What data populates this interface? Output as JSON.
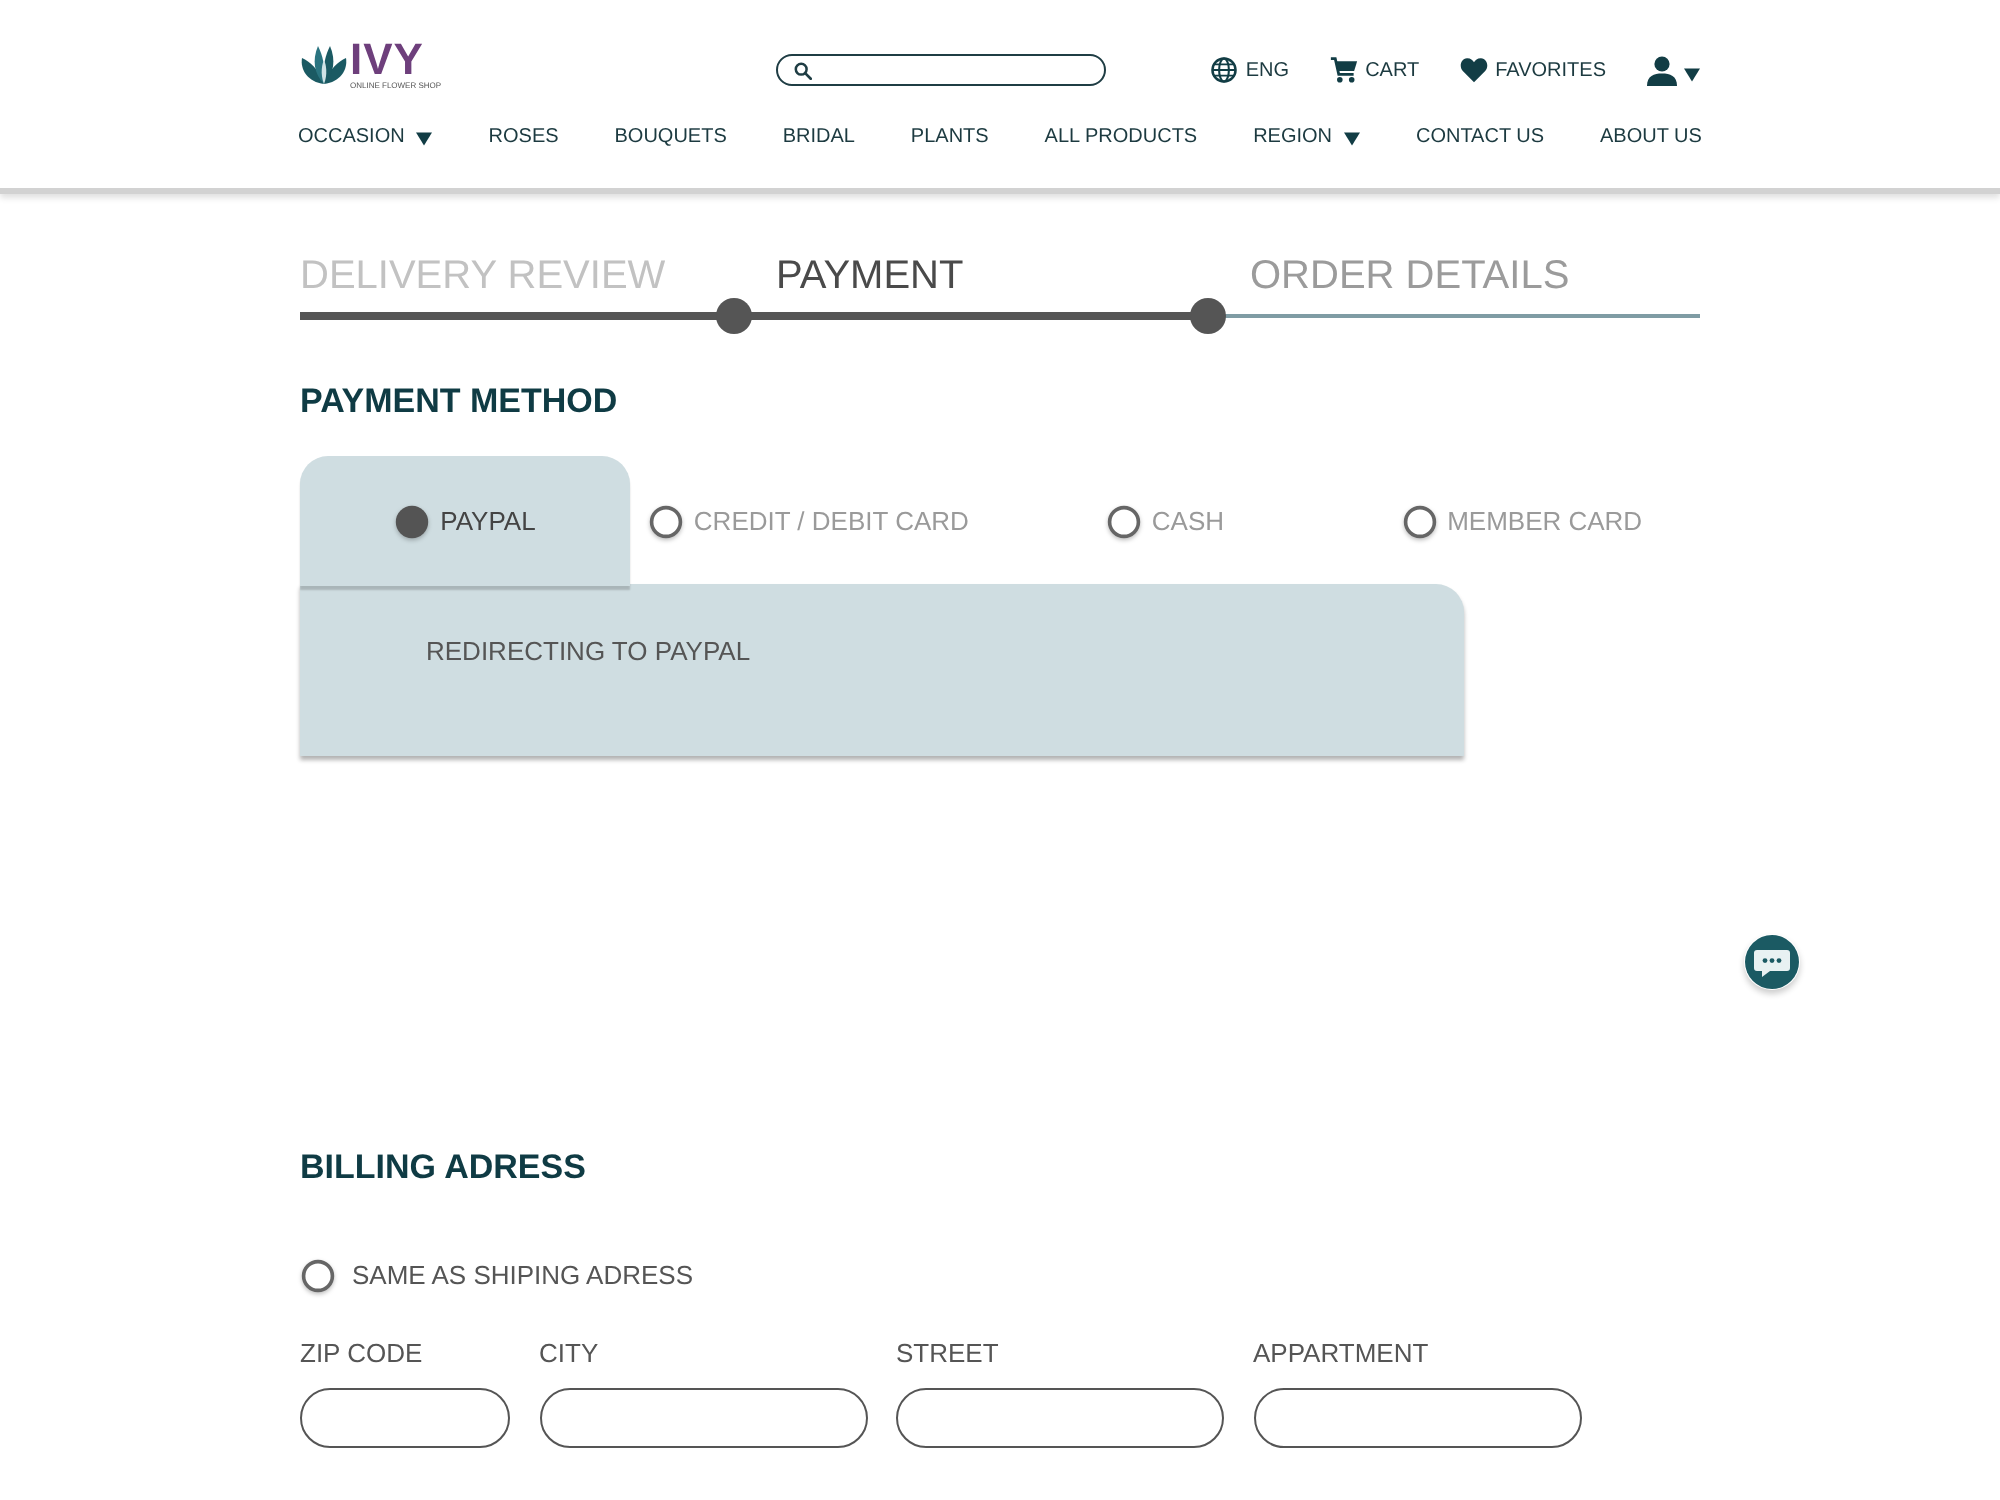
{
  "header": {
    "logo": {
      "name": "IVY",
      "tagline": "ONLINE FLOWER SHOP"
    },
    "utility_links": [
      {
        "kind": "language",
        "label": "ENG"
      },
      {
        "kind": "cart",
        "label": "CART"
      },
      {
        "kind": "favorites",
        "label": "FAVORITES"
      }
    ],
    "nav": [
      {
        "label": "OCCASION",
        "dropdown": true
      },
      {
        "label": "ROSES",
        "dropdown": false
      },
      {
        "label": "BOUQUETS",
        "dropdown": false
      },
      {
        "label": "BRIDAL",
        "dropdown": false
      },
      {
        "label": "PLANTS",
        "dropdown": false
      },
      {
        "label": "ALL PRODUCTS",
        "dropdown": false
      },
      {
        "label": "REGION",
        "dropdown": true
      },
      {
        "label": "CONTACT US",
        "dropdown": false
      },
      {
        "label": "ABOUT US",
        "dropdown": false
      }
    ]
  },
  "steps": [
    {
      "label": "DELIVERY REVIEW",
      "completed": true,
      "selected": false
    },
    {
      "label": "PAYMENT",
      "completed": false,
      "selected": true
    },
    {
      "label": "ORDER DETAILS",
      "completed": false,
      "selected": false
    }
  ],
  "payment_method": {
    "title": "PAYMENT METHOD",
    "options": [
      {
        "label": "PAYPAL",
        "selected": true
      },
      {
        "label": "CREDIT / DEBIT CARD",
        "selected": false
      },
      {
        "label": "CASH",
        "selected": false
      },
      {
        "label": "MEMBER CARD",
        "selected": false
      }
    ],
    "message": "REDIRECTING TO PAYPAL"
  },
  "billing": {
    "title": "BILLING ADRESS",
    "same_as_shipping": {
      "label": "SAME AS SHIPING ADRESS",
      "checked": false
    },
    "fields": [
      {
        "label": "ZIP CODE"
      },
      {
        "label": "CITY"
      },
      {
        "label": "STREET"
      },
      {
        "label": "APPARTMENT"
      }
    ]
  }
}
